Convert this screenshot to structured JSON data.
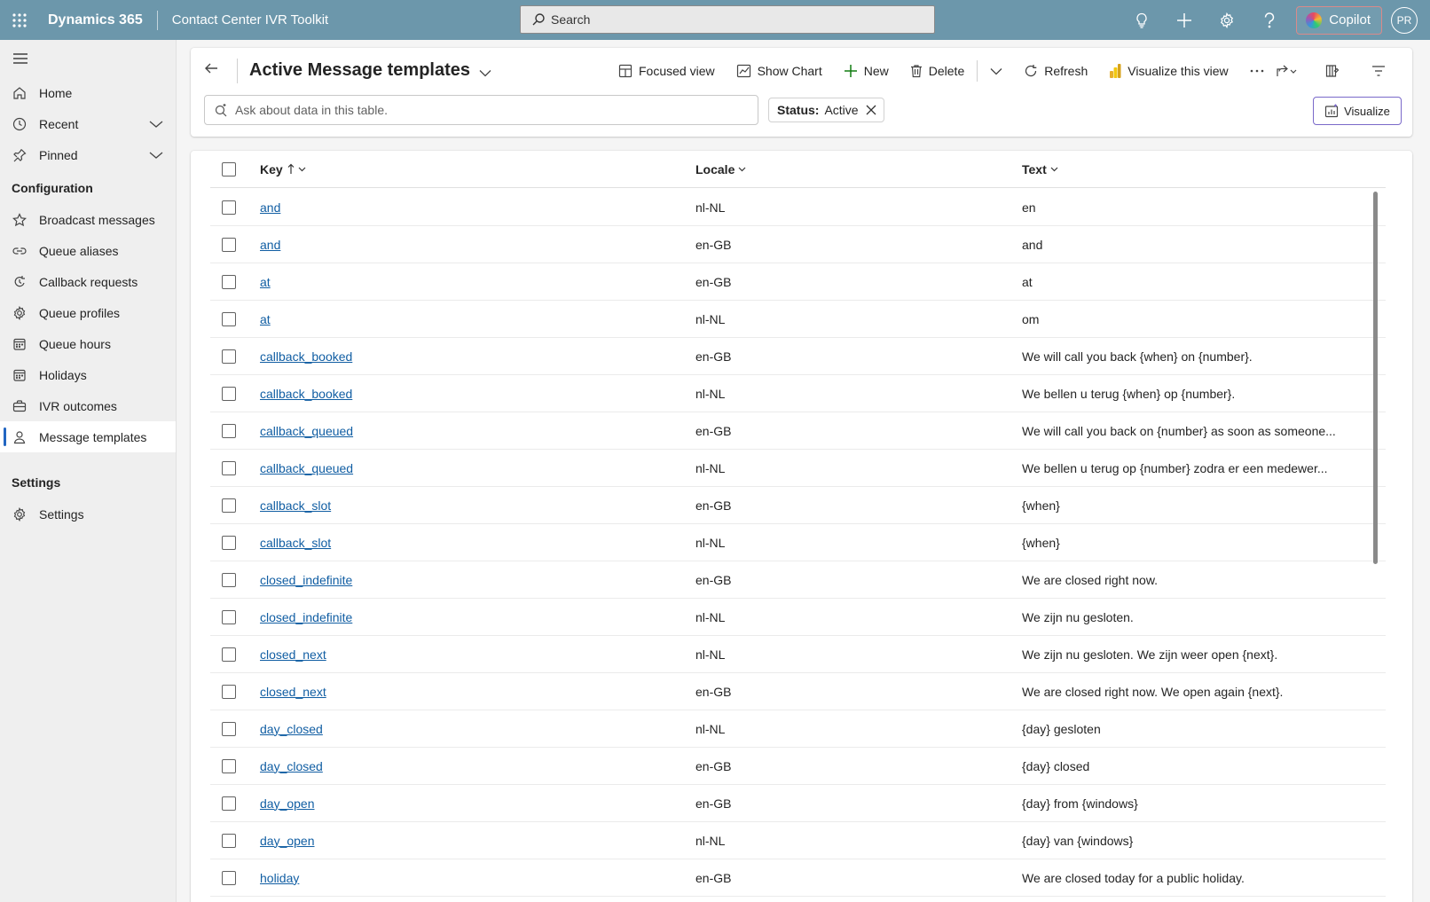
{
  "topbar": {
    "app_title": "Dynamics 365",
    "app_name": "Contact Center IVR Toolkit",
    "search_placeholder": "Search",
    "copilot_label": "Copilot",
    "avatar_initials": "PR",
    "bar_color": "#6c97ab"
  },
  "sidebar": {
    "items_top": [
      {
        "label": "Home",
        "icon": "home-icon"
      },
      {
        "label": "Recent",
        "icon": "clock-icon"
      },
      {
        "label": "Pinned",
        "icon": "pin-icon"
      }
    ],
    "config_heading": "Configuration",
    "config_items": [
      {
        "label": "Broadcast messages",
        "icon": "star-icon"
      },
      {
        "label": "Queue aliases",
        "icon": "link-icon"
      },
      {
        "label": "Callback requests",
        "icon": "callback-icon"
      },
      {
        "label": "Queue profiles",
        "icon": "gear-icon"
      },
      {
        "label": "Queue hours",
        "icon": "calendar-icon"
      },
      {
        "label": "Holidays",
        "icon": "calendar-icon"
      },
      {
        "label": "IVR outcomes",
        "icon": "briefcase-icon"
      },
      {
        "label": "Message templates",
        "icon": "person-icon",
        "active": true
      }
    ],
    "settings_heading": "Settings",
    "settings_items": [
      {
        "label": "Settings",
        "icon": "gear-icon"
      }
    ]
  },
  "command_bar": {
    "view_title": "Active Message templates",
    "focused_view": "Focused view",
    "show_chart": "Show Chart",
    "new": "New",
    "delete": "Delete",
    "refresh": "Refresh",
    "visualize_view": "Visualize this view",
    "ask_placeholder": "Ask about data in this table.",
    "filter_key": "Status:",
    "filter_value": "Active",
    "visualize_button": "Visualize",
    "accent": "#2266c2"
  },
  "grid": {
    "columns": [
      "Key",
      "Locale",
      "Text"
    ],
    "rows": [
      {
        "key": "and",
        "locale": "nl-NL",
        "text": "en"
      },
      {
        "key": "and",
        "locale": "en-GB",
        "text": "and"
      },
      {
        "key": "at",
        "locale": "en-GB",
        "text": "at"
      },
      {
        "key": "at",
        "locale": "nl-NL",
        "text": "om"
      },
      {
        "key": "callback_booked",
        "locale": "en-GB",
        "text": "We will call you back {when} on {number}."
      },
      {
        "key": "callback_booked",
        "locale": "nl-NL",
        "text": "We bellen u terug {when} op {number}."
      },
      {
        "key": "callback_queued",
        "locale": "en-GB",
        "text": "We will call you back on {number} as soon as someone..."
      },
      {
        "key": "callback_queued",
        "locale": "nl-NL",
        "text": "We bellen u terug op {number} zodra er een medewer..."
      },
      {
        "key": "callback_slot",
        "locale": "en-GB",
        "text": "{when}"
      },
      {
        "key": "callback_slot",
        "locale": "nl-NL",
        "text": "{when}"
      },
      {
        "key": "closed_indefinite",
        "locale": "en-GB",
        "text": "We are closed right now."
      },
      {
        "key": "closed_indefinite",
        "locale": "nl-NL",
        "text": "We zijn nu gesloten."
      },
      {
        "key": "closed_next",
        "locale": "nl-NL",
        "text": "We zijn nu gesloten. We zijn weer open {next}."
      },
      {
        "key": "closed_next",
        "locale": "en-GB",
        "text": "We are closed right now. We open again {next}."
      },
      {
        "key": "day_closed",
        "locale": "nl-NL",
        "text": "{day} gesloten"
      },
      {
        "key": "day_closed",
        "locale": "en-GB",
        "text": "{day} closed"
      },
      {
        "key": "day_open",
        "locale": "en-GB",
        "text": "{day} from {windows}"
      },
      {
        "key": "day_open",
        "locale": "nl-NL",
        "text": "{day} van {windows}"
      },
      {
        "key": "holiday",
        "locale": "en-GB",
        "text": "We are closed today for a public holiday."
      }
    ]
  }
}
